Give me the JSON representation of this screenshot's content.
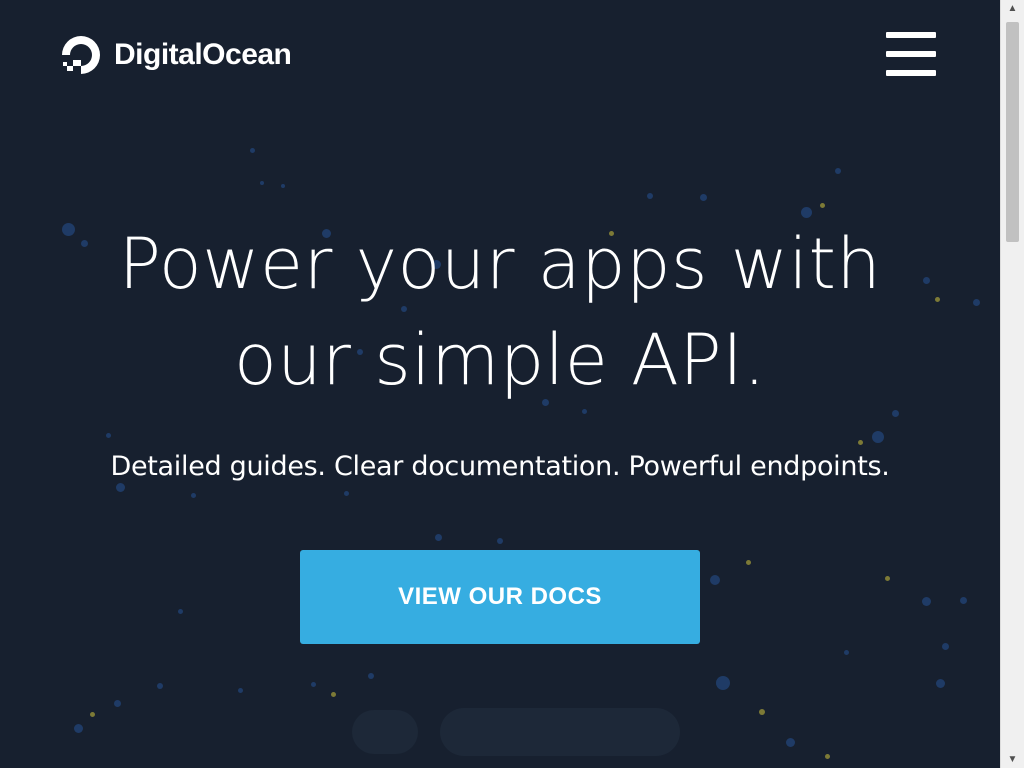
{
  "brand": {
    "name": "DigitalOcean",
    "logo_icon": "digitalocean-logo-icon"
  },
  "header": {
    "menu_icon": "hamburger-menu-icon"
  },
  "hero": {
    "title_line1": "Power your apps with",
    "title_line2": "our simple API.",
    "subtitle": "Detailed guides. Clear documentation. Powerful endpoints.",
    "cta_label": "VIEW OUR DOCS"
  },
  "colors": {
    "background": "#17202f",
    "accent": "#36ade1",
    "text": "#ffffff",
    "star_blue": "#1f3b66",
    "star_yellow": "#7d7a36"
  },
  "scrollbar": {
    "up_icon": "scroll-up-arrow-icon",
    "down_icon": "scroll-down-arrow-icon"
  }
}
